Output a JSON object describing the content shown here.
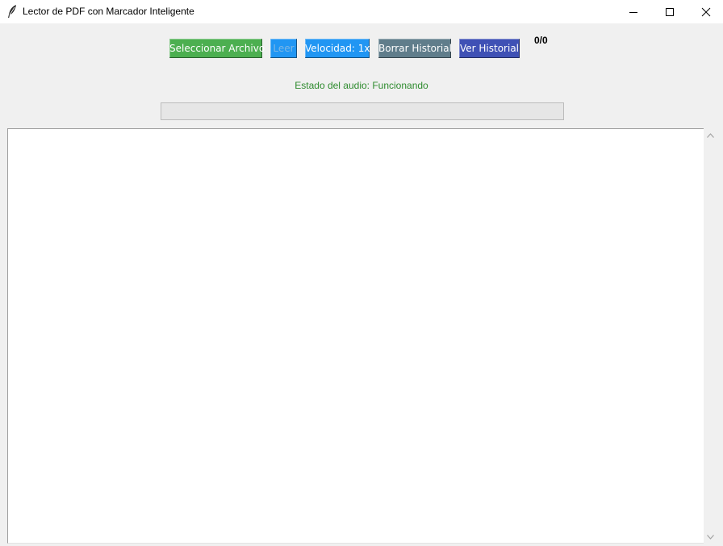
{
  "window": {
    "title": "Lector de PDF con Marcador Inteligente"
  },
  "toolbar": {
    "buttons": [
      {
        "label": "Seleccionar Archivo",
        "color": "#4caf50",
        "text_color": "#ffffff",
        "enabled": true
      },
      {
        "label": "Leer",
        "color": "#2196f3",
        "text_color": "#7ab6e6",
        "enabled": false
      },
      {
        "label": "Velocidad: 1x",
        "color": "#2196f3",
        "text_color": "#ffffff",
        "enabled": true
      },
      {
        "label": "Borrar Historial",
        "color": "#607d8b",
        "text_color": "#ffffff",
        "enabled": true
      },
      {
        "label": "Ver Historial",
        "color": "#3f51b5",
        "text_color": "#ffffff",
        "enabled": true
      }
    ],
    "page_counter": "0/0"
  },
  "status": {
    "audio_text": "Estado del audio: Funcionando",
    "audio_color": "#2e8b2e"
  },
  "progress": {
    "value_percent": 0
  },
  "text_area": {
    "content": ""
  }
}
